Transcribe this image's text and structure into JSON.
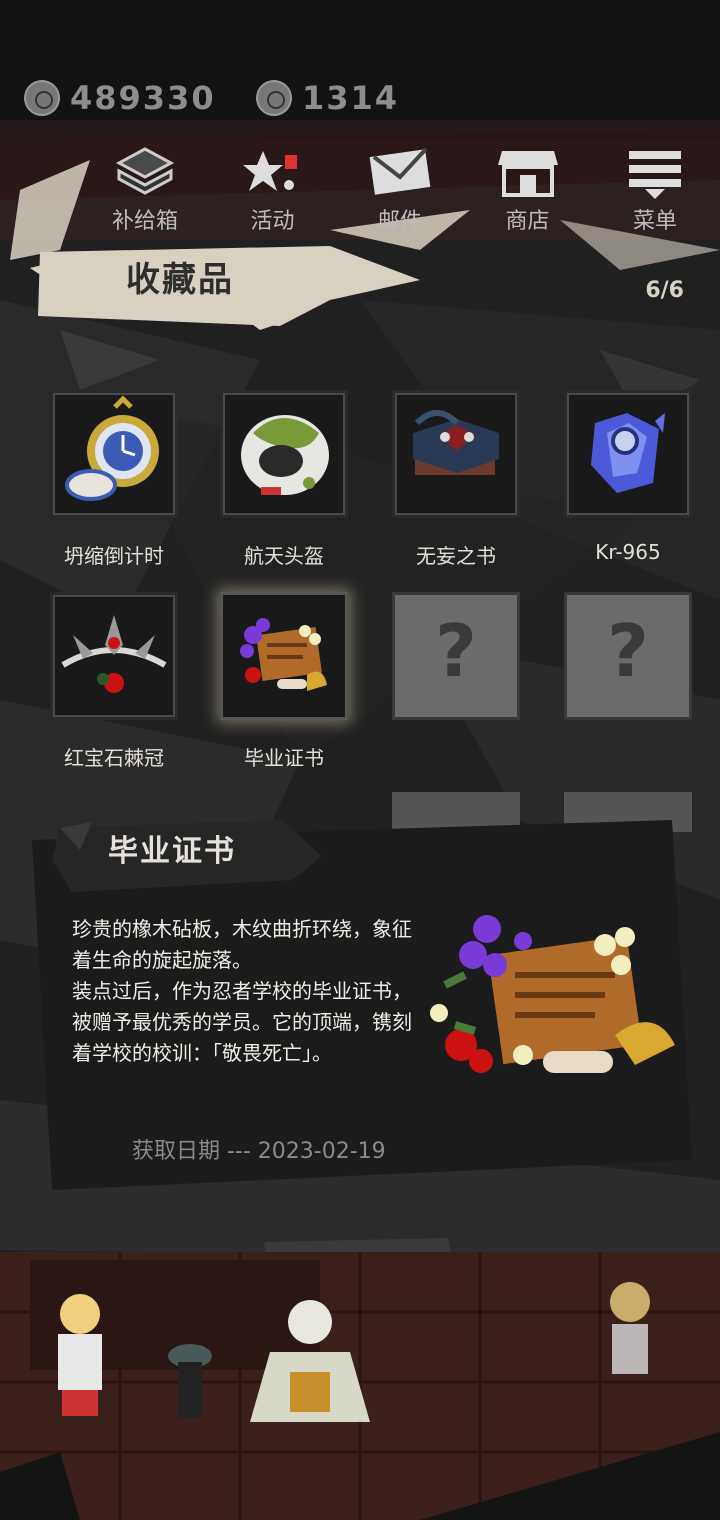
{
  "currencies": [
    {
      "icon": "coin-icon",
      "value": "489330"
    },
    {
      "icon": "gem-icon",
      "value": "1314"
    }
  ],
  "nav": [
    {
      "icon": "supply-box-icon",
      "label": "补给箱"
    },
    {
      "icon": "event-icon",
      "label": "活动"
    },
    {
      "icon": "mail-icon",
      "label": "邮件"
    },
    {
      "icon": "shop-icon",
      "label": "商店"
    },
    {
      "icon": "menu-icon",
      "label": "菜单"
    }
  ],
  "page": {
    "title": "收藏品",
    "count": "6/6"
  },
  "collection": [
    {
      "name": "坍缩倒计时",
      "icon": "pocket-watch-icon",
      "locked": false
    },
    {
      "name": "航天头盔",
      "icon": "space-helmet-icon",
      "locked": false
    },
    {
      "name": "无妄之书",
      "icon": "cursed-book-icon",
      "locked": false
    },
    {
      "name": "Kr-965",
      "icon": "crystal-icon",
      "locked": false
    },
    {
      "name": "红宝石棘冠",
      "icon": "ruby-crown-icon",
      "locked": false
    },
    {
      "name": "毕业证书",
      "icon": "diploma-icon",
      "locked": false,
      "selected": true
    },
    {
      "name": "",
      "icon": "question-mark-icon",
      "locked": true,
      "locked_symbol": "?"
    },
    {
      "name": "",
      "icon": "question-mark-icon",
      "locked": true,
      "locked_symbol": "?"
    }
  ],
  "detail": {
    "title": "毕业证书",
    "description": "珍贵的橡木砧板，木纹曲折环绕，象征着生命的旋起旋落。\n装点过后，作为忍者学校的毕业证书，被赠予最优秀的学员。它的顶端，镌刻着学校的校训：「敬畏死亡」。",
    "date_label": "获取日期 --- 2023-02-19"
  },
  "back": {
    "icon": "back-arrow-icon"
  },
  "colors": {
    "background": "#141414",
    "banner": "#d8d1c2",
    "panel": "#1d1d1d",
    "locked_slot": "#6b6b6b"
  }
}
